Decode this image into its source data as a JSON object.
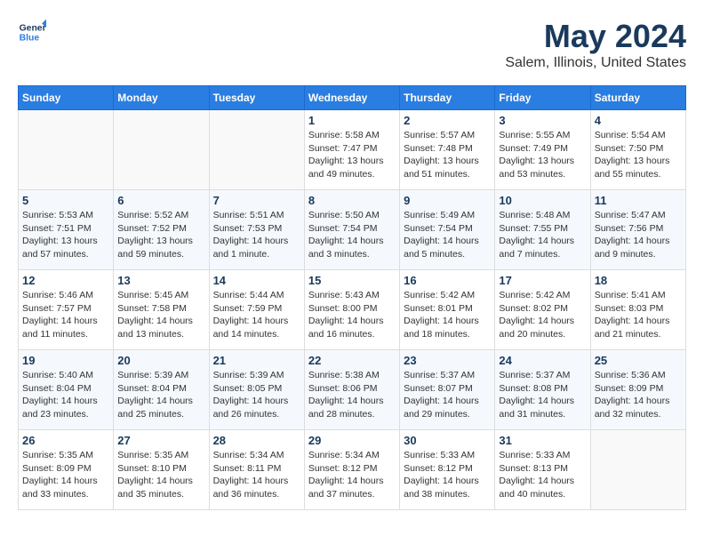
{
  "header": {
    "logo_line1": "General",
    "logo_line2": "Blue",
    "title": "May 2024",
    "subtitle": "Salem, Illinois, United States"
  },
  "days_of_week": [
    "Sunday",
    "Monday",
    "Tuesday",
    "Wednesday",
    "Thursday",
    "Friday",
    "Saturday"
  ],
  "weeks": [
    [
      {
        "day": "",
        "info": ""
      },
      {
        "day": "",
        "info": ""
      },
      {
        "day": "",
        "info": ""
      },
      {
        "day": "1",
        "info": "Sunrise: 5:58 AM\nSunset: 7:47 PM\nDaylight: 13 hours\nand 49 minutes."
      },
      {
        "day": "2",
        "info": "Sunrise: 5:57 AM\nSunset: 7:48 PM\nDaylight: 13 hours\nand 51 minutes."
      },
      {
        "day": "3",
        "info": "Sunrise: 5:55 AM\nSunset: 7:49 PM\nDaylight: 13 hours\nand 53 minutes."
      },
      {
        "day": "4",
        "info": "Sunrise: 5:54 AM\nSunset: 7:50 PM\nDaylight: 13 hours\nand 55 minutes."
      }
    ],
    [
      {
        "day": "5",
        "info": "Sunrise: 5:53 AM\nSunset: 7:51 PM\nDaylight: 13 hours\nand 57 minutes."
      },
      {
        "day": "6",
        "info": "Sunrise: 5:52 AM\nSunset: 7:52 PM\nDaylight: 13 hours\nand 59 minutes."
      },
      {
        "day": "7",
        "info": "Sunrise: 5:51 AM\nSunset: 7:53 PM\nDaylight: 14 hours\nand 1 minute."
      },
      {
        "day": "8",
        "info": "Sunrise: 5:50 AM\nSunset: 7:54 PM\nDaylight: 14 hours\nand 3 minutes."
      },
      {
        "day": "9",
        "info": "Sunrise: 5:49 AM\nSunset: 7:54 PM\nDaylight: 14 hours\nand 5 minutes."
      },
      {
        "day": "10",
        "info": "Sunrise: 5:48 AM\nSunset: 7:55 PM\nDaylight: 14 hours\nand 7 minutes."
      },
      {
        "day": "11",
        "info": "Sunrise: 5:47 AM\nSunset: 7:56 PM\nDaylight: 14 hours\nand 9 minutes."
      }
    ],
    [
      {
        "day": "12",
        "info": "Sunrise: 5:46 AM\nSunset: 7:57 PM\nDaylight: 14 hours\nand 11 minutes."
      },
      {
        "day": "13",
        "info": "Sunrise: 5:45 AM\nSunset: 7:58 PM\nDaylight: 14 hours\nand 13 minutes."
      },
      {
        "day": "14",
        "info": "Sunrise: 5:44 AM\nSunset: 7:59 PM\nDaylight: 14 hours\nand 14 minutes."
      },
      {
        "day": "15",
        "info": "Sunrise: 5:43 AM\nSunset: 8:00 PM\nDaylight: 14 hours\nand 16 minutes."
      },
      {
        "day": "16",
        "info": "Sunrise: 5:42 AM\nSunset: 8:01 PM\nDaylight: 14 hours\nand 18 minutes."
      },
      {
        "day": "17",
        "info": "Sunrise: 5:42 AM\nSunset: 8:02 PM\nDaylight: 14 hours\nand 20 minutes."
      },
      {
        "day": "18",
        "info": "Sunrise: 5:41 AM\nSunset: 8:03 PM\nDaylight: 14 hours\nand 21 minutes."
      }
    ],
    [
      {
        "day": "19",
        "info": "Sunrise: 5:40 AM\nSunset: 8:04 PM\nDaylight: 14 hours\nand 23 minutes."
      },
      {
        "day": "20",
        "info": "Sunrise: 5:39 AM\nSunset: 8:04 PM\nDaylight: 14 hours\nand 25 minutes."
      },
      {
        "day": "21",
        "info": "Sunrise: 5:39 AM\nSunset: 8:05 PM\nDaylight: 14 hours\nand 26 minutes."
      },
      {
        "day": "22",
        "info": "Sunrise: 5:38 AM\nSunset: 8:06 PM\nDaylight: 14 hours\nand 28 minutes."
      },
      {
        "day": "23",
        "info": "Sunrise: 5:37 AM\nSunset: 8:07 PM\nDaylight: 14 hours\nand 29 minutes."
      },
      {
        "day": "24",
        "info": "Sunrise: 5:37 AM\nSunset: 8:08 PM\nDaylight: 14 hours\nand 31 minutes."
      },
      {
        "day": "25",
        "info": "Sunrise: 5:36 AM\nSunset: 8:09 PM\nDaylight: 14 hours\nand 32 minutes."
      }
    ],
    [
      {
        "day": "26",
        "info": "Sunrise: 5:35 AM\nSunset: 8:09 PM\nDaylight: 14 hours\nand 33 minutes."
      },
      {
        "day": "27",
        "info": "Sunrise: 5:35 AM\nSunset: 8:10 PM\nDaylight: 14 hours\nand 35 minutes."
      },
      {
        "day": "28",
        "info": "Sunrise: 5:34 AM\nSunset: 8:11 PM\nDaylight: 14 hours\nand 36 minutes."
      },
      {
        "day": "29",
        "info": "Sunrise: 5:34 AM\nSunset: 8:12 PM\nDaylight: 14 hours\nand 37 minutes."
      },
      {
        "day": "30",
        "info": "Sunrise: 5:33 AM\nSunset: 8:12 PM\nDaylight: 14 hours\nand 38 minutes."
      },
      {
        "day": "31",
        "info": "Sunrise: 5:33 AM\nSunset: 8:13 PM\nDaylight: 14 hours\nand 40 minutes."
      },
      {
        "day": "",
        "info": ""
      }
    ]
  ]
}
